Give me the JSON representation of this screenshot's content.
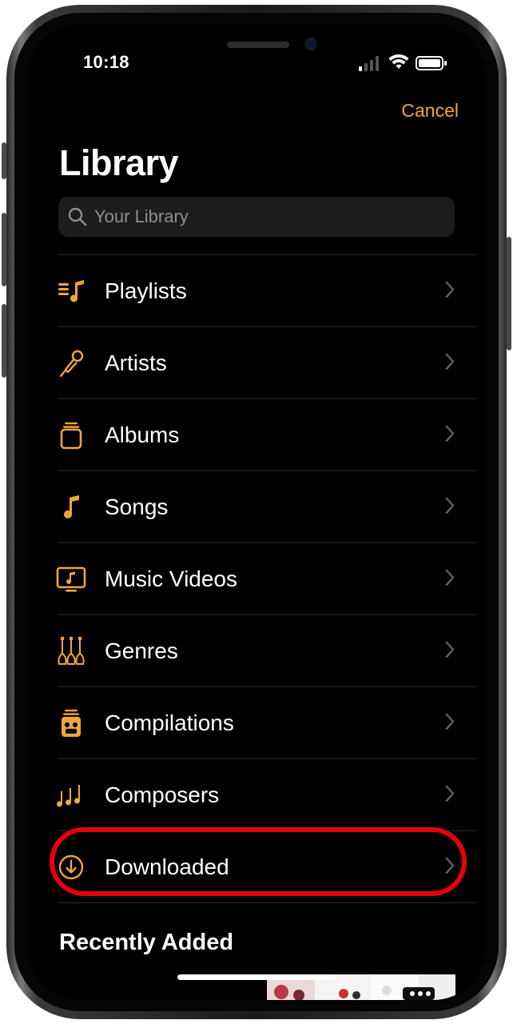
{
  "status": {
    "time": "10:18"
  },
  "nav": {
    "cancel_label": "Cancel"
  },
  "page": {
    "title": "Library"
  },
  "search": {
    "placeholder": "Your Library",
    "icon": "search-icon"
  },
  "items": [
    {
      "label": "Playlists",
      "icon": "playlists-icon"
    },
    {
      "label": "Artists",
      "icon": "microphone-icon"
    },
    {
      "label": "Albums",
      "icon": "album-stack-icon"
    },
    {
      "label": "Songs",
      "icon": "music-note-icon"
    },
    {
      "label": "Music Videos",
      "icon": "music-video-tv-icon"
    },
    {
      "label": "Genres",
      "icon": "guitars-icon"
    },
    {
      "label": "Compilations",
      "icon": "compilation-box-icon"
    },
    {
      "label": "Composers",
      "icon": "notes-icon"
    },
    {
      "label": "Downloaded",
      "icon": "download-circle-icon"
    }
  ],
  "recently_added": {
    "heading": "Recently Added"
  },
  "colors": {
    "accent": "#f0a53c",
    "background": "#000000",
    "highlight": "#e8000b",
    "separator": "#2a2a2c"
  }
}
